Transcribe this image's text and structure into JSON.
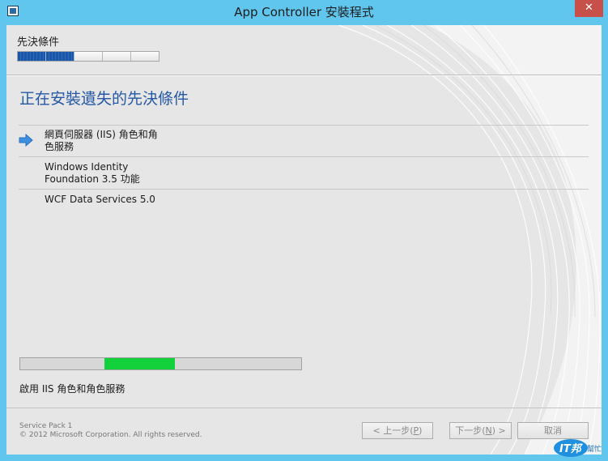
{
  "window": {
    "title": "App Controller 安裝程式",
    "close_glyph": "✕"
  },
  "steps": {
    "label": "先決條件",
    "total": 5,
    "completed": 2
  },
  "page_title": "正在安裝遺失的先決條件",
  "items": [
    {
      "line1": "網頁伺服器 (IIS) 角色和角",
      "line2": "色服務",
      "current": true
    },
    {
      "line1": "Windows Identity",
      "line2": "Foundation 3.5 功能",
      "current": false
    },
    {
      "line1": "WCF Data Services 5.0",
      "line2": "",
      "current": false
    }
  ],
  "install_progress": {
    "status": "啟用 IIS 角色和角色服務",
    "fill_start_fraction": 0.3,
    "fill_fraction": 0.25,
    "color": "#13d13b"
  },
  "footer": {
    "service_pack": "Service Pack 1",
    "copyright": "© 2012 Microsoft Corporation. All rights reserved."
  },
  "buttons": {
    "back_prefix": "< 上一步(",
    "back_mn": "P",
    "back_suffix": ")",
    "next_prefix": "下一步(",
    "next_mn": "N",
    "next_suffix": ") >",
    "cancel": "取消"
  },
  "watermark": {
    "logo_text": "IT邦",
    "logo_sub": "幫忙"
  },
  "colors": {
    "frame": "#60c6ee",
    "title_blue": "#2458a5",
    "step_done": "#1a55a7",
    "close_red": "#c7504a"
  }
}
